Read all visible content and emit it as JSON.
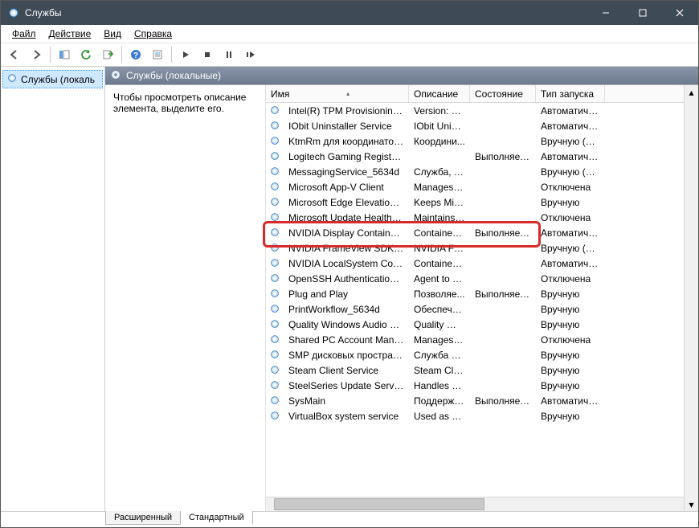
{
  "window": {
    "title": "Службы"
  },
  "menus": {
    "file": "Файл",
    "action": "Действие",
    "view": "Вид",
    "help": "Справка"
  },
  "tree": {
    "root": "Службы (локаль"
  },
  "pane": {
    "header": "Службы (локальные)"
  },
  "desc": {
    "text": "Чтобы просмотреть описание элемента, выделите его."
  },
  "columns": {
    "name": "Имя",
    "description": "Описание",
    "status": "Состояние",
    "startup": "Тип запуска"
  },
  "tabs": {
    "extended": "Расширенный",
    "standard": "Стандартный"
  },
  "services": [
    {
      "name": "Intel(R) TPM Provisioning S...",
      "desc": "Version: 1.6...",
      "status": "",
      "startup": "Автоматиче..."
    },
    {
      "name": "IObit Uninstaller Service",
      "desc": "IObit Unins...",
      "status": "",
      "startup": "Автоматиче..."
    },
    {
      "name": "KtmRm для координатора ...",
      "desc": "Координи...",
      "status": "",
      "startup": "Вручную (ак..."
    },
    {
      "name": "Logitech Gaming Registry S...",
      "desc": "",
      "status": "Выполняется",
      "startup": "Автоматиче..."
    },
    {
      "name": "MessagingService_5634d",
      "desc": "Служба, о...",
      "status": "",
      "startup": "Вручную (ак..."
    },
    {
      "name": "Microsoft App-V Client",
      "desc": "Manages A...",
      "status": "",
      "startup": "Отключена"
    },
    {
      "name": "Microsoft Edge Elevation Se...",
      "desc": "Keeps Micr...",
      "status": "",
      "startup": "Вручную"
    },
    {
      "name": "Microsoft Update Health Se...",
      "desc": "Maintains ...",
      "status": "",
      "startup": "Отключена"
    },
    {
      "name": "NVIDIA Display Container LS",
      "desc": "Container ...",
      "status": "Выполняется",
      "startup": "Автоматиче..."
    },
    {
      "name": "NVIDIA FrameView SDK servi...",
      "desc": "NVIDIA Fra...",
      "status": "",
      "startup": "Вручную (ак..."
    },
    {
      "name": "NVIDIA LocalSystem Contai...",
      "desc": "Container ...",
      "status": "",
      "startup": "Автоматиче..."
    },
    {
      "name": "OpenSSH Authentication A...",
      "desc": "Agent to h...",
      "status": "",
      "startup": "Отключена"
    },
    {
      "name": "Plug and Play",
      "desc": "Позволяе...",
      "status": "Выполняется",
      "startup": "Вручную"
    },
    {
      "name": "PrintWorkflow_5634d",
      "desc": "Обеспечи...",
      "status": "",
      "startup": "Вручную"
    },
    {
      "name": "Quality Windows Audio Vid...",
      "desc": "Quality Wi...",
      "status": "",
      "startup": "Вручную"
    },
    {
      "name": "Shared PC Account Manager",
      "desc": "Manages p...",
      "status": "",
      "startup": "Отключена"
    },
    {
      "name": "SMP дисковых пространств...",
      "desc": "Служба уз...",
      "status": "",
      "startup": "Вручную"
    },
    {
      "name": "Steam Client Service",
      "desc": "Steam Clie...",
      "status": "",
      "startup": "Вручную"
    },
    {
      "name": "SteelSeries Update Service",
      "desc": "Handles u...",
      "status": "",
      "startup": "Вручную"
    },
    {
      "name": "SysMain",
      "desc": "Поддержи...",
      "status": "Выполняется",
      "startup": "Автоматиче..."
    },
    {
      "name": "VirtualBox system service",
      "desc": "Used as a ...",
      "status": "",
      "startup": "Вручную"
    }
  ],
  "highlight_index": 8
}
